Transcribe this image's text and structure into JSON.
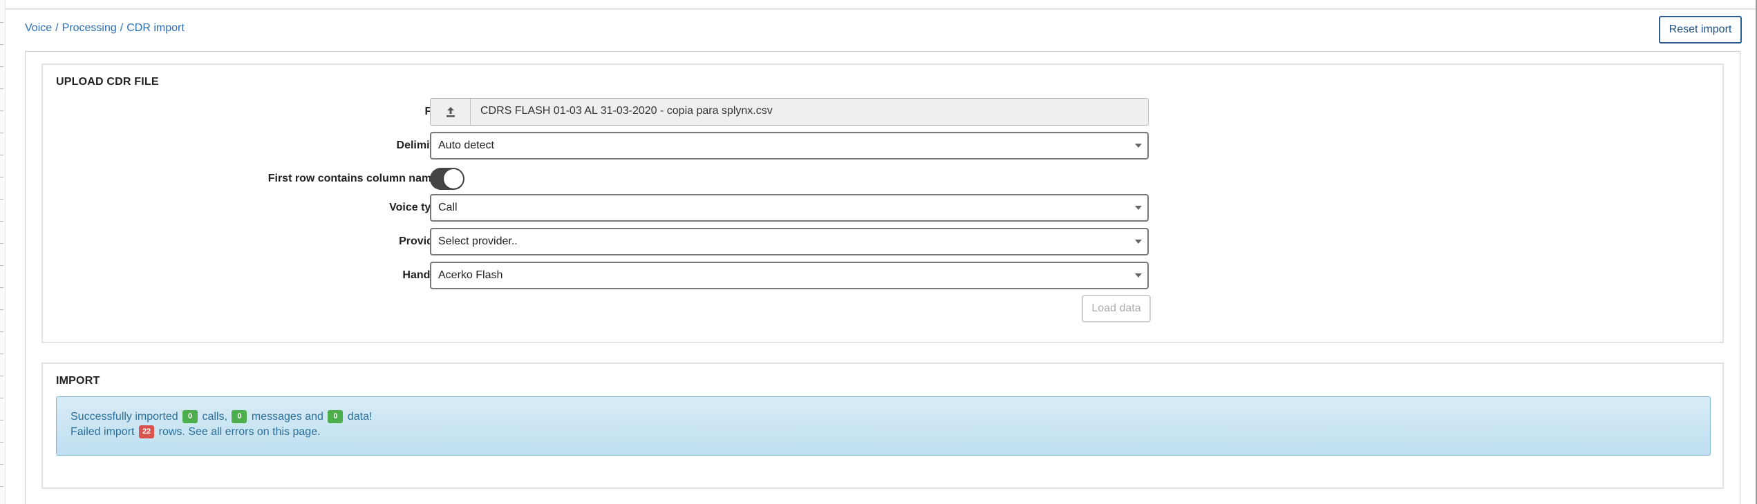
{
  "breadcrumb": {
    "items": [
      "Voice",
      "Processing",
      "CDR import"
    ],
    "separator": "/"
  },
  "reset_button": "Reset import",
  "upload": {
    "title": "UPLOAD CDR FILE",
    "file_label": "File",
    "file_icon": "upload-icon",
    "file_name": "CDRS FLASH 01-03 AL 31-03-2020 - copia para splynx.csv",
    "delimiter_label": "Delimiter",
    "delimiter_value": "Auto detect",
    "first_row_label": "First row contains column names",
    "first_row_enabled": true,
    "voice_type_label": "Voice type",
    "voice_type_value": "Call",
    "provider_label": "Provider",
    "provider_value": "Select provider..",
    "handler_label": "Handler",
    "handler_value": "Acerko Flash",
    "load_button": "Load data"
  },
  "import": {
    "title": "IMPORT",
    "success_prefix": "Successfully imported",
    "calls_count": "0",
    "calls_text": "calls,",
    "messages_count": "0",
    "messages_text": "messages and",
    "data_count": "0",
    "data_text": "data!",
    "failed_prefix": "Failed import",
    "failed_count": "22",
    "failed_middle": "rows. See all errors on",
    "failed_link": "this page",
    "failed_end": "."
  },
  "colors": {
    "link": "#2a6eb5",
    "success_badge": "#4cae4c",
    "error_badge": "#d9534f",
    "alert_bg": "#cfe6f3"
  }
}
